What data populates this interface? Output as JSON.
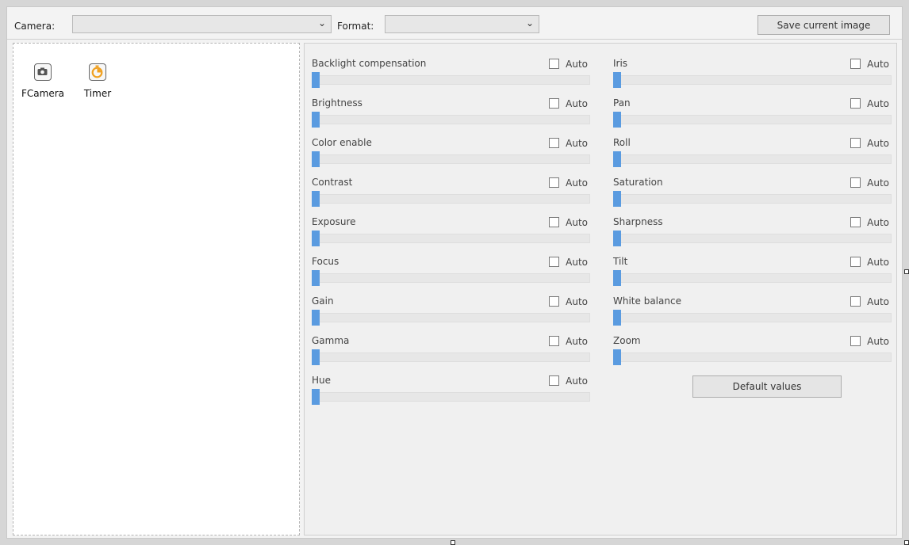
{
  "toolbar": {
    "camera_label": "Camera:",
    "camera_value": "",
    "format_label": "Format:",
    "format_value": "",
    "save_label": "Save current image"
  },
  "tools": [
    {
      "label": "FCamera",
      "icon": "camera-icon"
    },
    {
      "label": "Timer",
      "icon": "timer-icon"
    }
  ],
  "auto_label": "Auto",
  "controls_left": [
    {
      "name": "Backlight compensation",
      "auto": false,
      "value": 0
    },
    {
      "name": "Brightness",
      "auto": false,
      "value": 0
    },
    {
      "name": "Color enable",
      "auto": false,
      "value": 0
    },
    {
      "name": "Contrast",
      "auto": false,
      "value": 0
    },
    {
      "name": "Exposure",
      "auto": false,
      "value": 0
    },
    {
      "name": "Focus",
      "auto": false,
      "value": 0
    },
    {
      "name": "Gain",
      "auto": false,
      "value": 0
    },
    {
      "name": "Gamma",
      "auto": false,
      "value": 0
    },
    {
      "name": "Hue",
      "auto": false,
      "value": 0
    }
  ],
  "controls_right": [
    {
      "name": "Iris",
      "auto": false,
      "value": 0
    },
    {
      "name": "Pan",
      "auto": false,
      "value": 0
    },
    {
      "name": "Roll",
      "auto": false,
      "value": 0
    },
    {
      "name": "Saturation",
      "auto": false,
      "value": 0
    },
    {
      "name": "Sharpness",
      "auto": false,
      "value": 0
    },
    {
      "name": "Tilt",
      "auto": false,
      "value": 0
    },
    {
      "name": "White balance",
      "auto": false,
      "value": 0
    },
    {
      "name": "Zoom",
      "auto": false,
      "value": 0
    }
  ],
  "default_values_label": "Default values",
  "colors": {
    "slider_thumb": "#5a9be0",
    "timer_accent": "#f0a020"
  }
}
